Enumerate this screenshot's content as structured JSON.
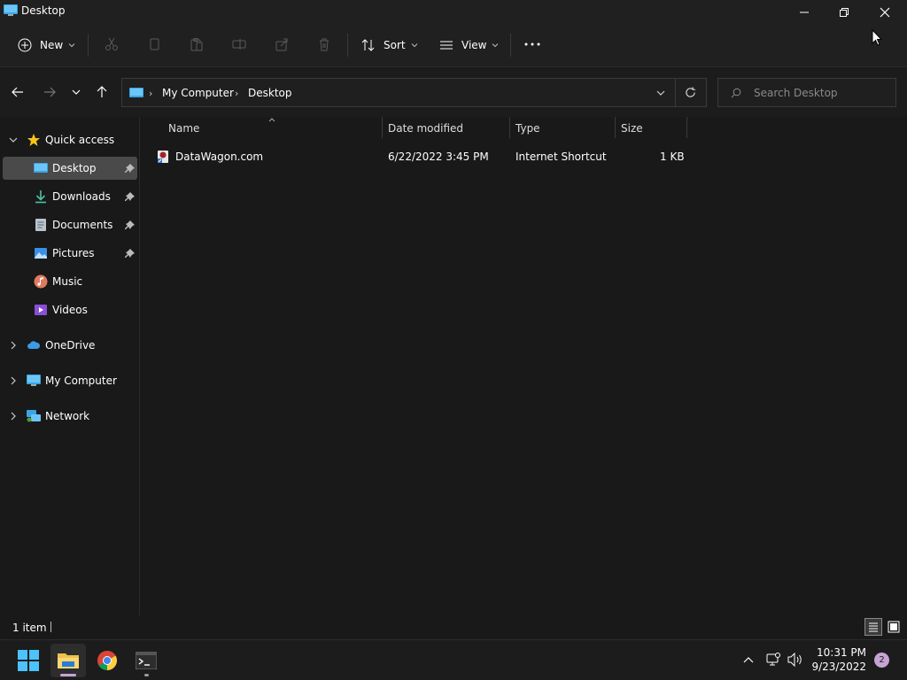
{
  "window": {
    "title": "Desktop"
  },
  "toolbar": {
    "new_label": "New",
    "sort_label": "Sort",
    "view_label": "View"
  },
  "address": {
    "crumbs": [
      "My Computer",
      "Desktop"
    ],
    "search_placeholder": "Search Desktop"
  },
  "nav": {
    "quick_access": "Quick access",
    "items": [
      {
        "label": "Desktop",
        "pinned": true,
        "icon": "desktop-icon"
      },
      {
        "label": "Downloads",
        "pinned": true,
        "icon": "downloads-icon"
      },
      {
        "label": "Documents",
        "pinned": true,
        "icon": "documents-icon"
      },
      {
        "label": "Pictures",
        "pinned": true,
        "icon": "pictures-icon"
      },
      {
        "label": "Music",
        "pinned": false,
        "icon": "music-icon"
      },
      {
        "label": "Videos",
        "pinned": false,
        "icon": "videos-icon"
      }
    ],
    "onedrive": "OneDrive",
    "my_computer": "My Computer",
    "network": "Network"
  },
  "columns": {
    "name": "Name",
    "date": "Date modified",
    "type": "Type",
    "size": "Size"
  },
  "files": [
    {
      "name": "DataWagon.com",
      "date": "6/22/2022 3:45 PM",
      "type": "Internet Shortcut",
      "size": "1 KB"
    }
  ],
  "status": {
    "count": "1 item"
  },
  "taskbar": {
    "time": "10:31 PM",
    "date": "9/23/2022",
    "notifications": "2"
  },
  "colors": {
    "accent": "#0078d4",
    "folder_yellow": "#f0c04a",
    "selection": "#4a4a4a"
  }
}
